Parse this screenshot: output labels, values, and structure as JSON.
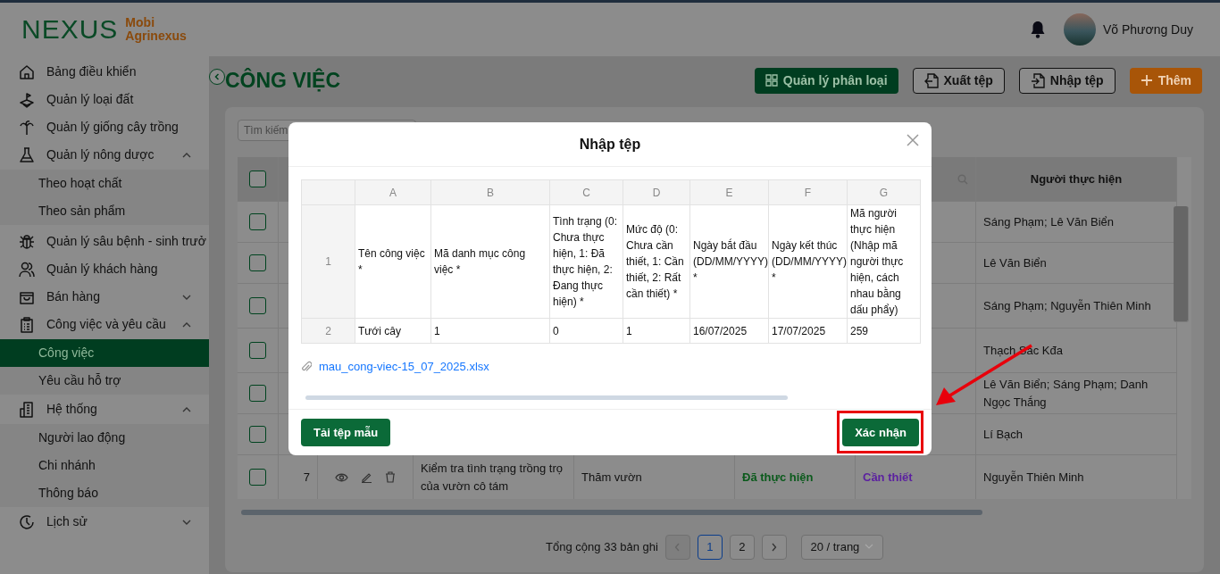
{
  "brand": {
    "logo": "NEXUS",
    "line_1": "Mobi",
    "line_2": "Agrinexus"
  },
  "user": {
    "name": "Võ Phương Duy"
  },
  "sidebar": {
    "items": [
      {
        "label": "Bảng điều khiển",
        "selected": false
      },
      {
        "label": "Quản lý loại đất",
        "selected": false
      },
      {
        "label": "Quản lý giống cây trồng",
        "selected": false
      },
      {
        "label": "Quản lý nông dược",
        "selected": false,
        "expanded": true,
        "children": [
          {
            "label": "Theo hoạt chất",
            "selected": false
          },
          {
            "label": "Theo sản phẩm",
            "selected": false
          }
        ]
      },
      {
        "label": "Quản lý sâu bệnh - sinh trưở",
        "selected": false
      },
      {
        "label": "Quản lý khách hàng",
        "selected": false
      },
      {
        "label": "Bán hàng",
        "selected": false,
        "expanded": false
      },
      {
        "label": "Công việc và yêu cầu",
        "selected": false,
        "expanded": true,
        "children": [
          {
            "label": "Công việc",
            "selected": true
          },
          {
            "label": "Yêu cầu hỗ trợ",
            "selected": false
          }
        ]
      },
      {
        "label": "Hệ thống",
        "selected": false,
        "expanded": true,
        "children": [
          {
            "label": "Người lao động",
            "selected": false
          },
          {
            "label": "Chi nhánh",
            "selected": false
          },
          {
            "label": "Thông báo",
            "selected": false
          }
        ]
      },
      {
        "label": "Lịch sử",
        "selected": false,
        "expanded": false
      }
    ]
  },
  "page": {
    "title": "CÔNG VIỆC",
    "actions": [
      {
        "kind": "primary",
        "label": "Quản lý phân loại"
      },
      {
        "kind": "export",
        "label": "Xuất tệp"
      },
      {
        "kind": "import",
        "label": "Nhập tệp"
      },
      {
        "kind": "add",
        "label": "Thêm"
      }
    ]
  },
  "search": {
    "placeholder": "Tìm kiếm"
  },
  "table": {
    "header_checked": false,
    "columns": [
      "Người thực hiện"
    ],
    "rows": [
      {
        "checked": false,
        "people": "Sáng Phạm; Lê  Văn Biển"
      },
      {
        "checked": false,
        "people": "Lê  Văn Biển"
      },
      {
        "checked": false,
        "people": "Sáng Phạm; Nguyễn  Thiên Minh"
      },
      {
        "checked": false,
        "people": "Thạch Sác Kđa"
      },
      {
        "checked": false,
        "people": "Lê  Văn Biển; Sáng Phạm; Danh  Ngọc Thắng"
      },
      {
        "checked": false,
        "people": "Lí  Bạch"
      },
      {
        "checked": false,
        "index": "7",
        "name": "Kiểm tra tình trạng trồng trọ của vườn cô tám",
        "category": "Thăm vườn",
        "status": {
          "text": "Đã thực hiện",
          "color": "#0b5a1c"
        },
        "priority": {
          "text": "Cần thiết",
          "color": "#5b1fa0"
        },
        "people": "Nguyễn  Thiên Minh"
      }
    ]
  },
  "pagination": {
    "total": "Tổng cộng 33 bản ghi",
    "prev_disabled": true,
    "pages": [
      {
        "label": "1",
        "selected": true
      },
      {
        "label": "2",
        "selected": false
      }
    ],
    "page_size": "20 / trang"
  },
  "modal": {
    "title": "Nhập tệp",
    "sheet": {
      "columns": [
        "A",
        "B",
        "C",
        "D",
        "E",
        "F",
        "G"
      ],
      "rows": [
        {
          "number": "1",
          "cells": [
            "Tên công việc *",
            "Mã danh mục công việc *",
            "Tình trạng (0: Chưa thực hiện, 1: Đã thực hiện, 2: Đang thực hiện) *",
            "Mức độ (0: Chưa cần thiết, 1: Cần thiết, 2: Rất cần thiết) *",
            "Ngày bắt đầu (DD/MM/YYYY) *",
            "Ngày kết thúc (DD/MM/YYYY) *",
            "Mã người thực hiện (Nhập mã người thực hiện, cách nhau bằng dấu phẩy)"
          ]
        },
        {
          "number": "2",
          "cells": [
            "Tưới cây",
            "1",
            "0",
            "1",
            "16/07/2025",
            "17/07/2025",
            "259"
          ]
        }
      ]
    },
    "file_name": "mau_cong-viec-15_07_2025.xlsx",
    "template_button": "Tải tệp mẫu",
    "confirm_button": "Xác nhận"
  }
}
